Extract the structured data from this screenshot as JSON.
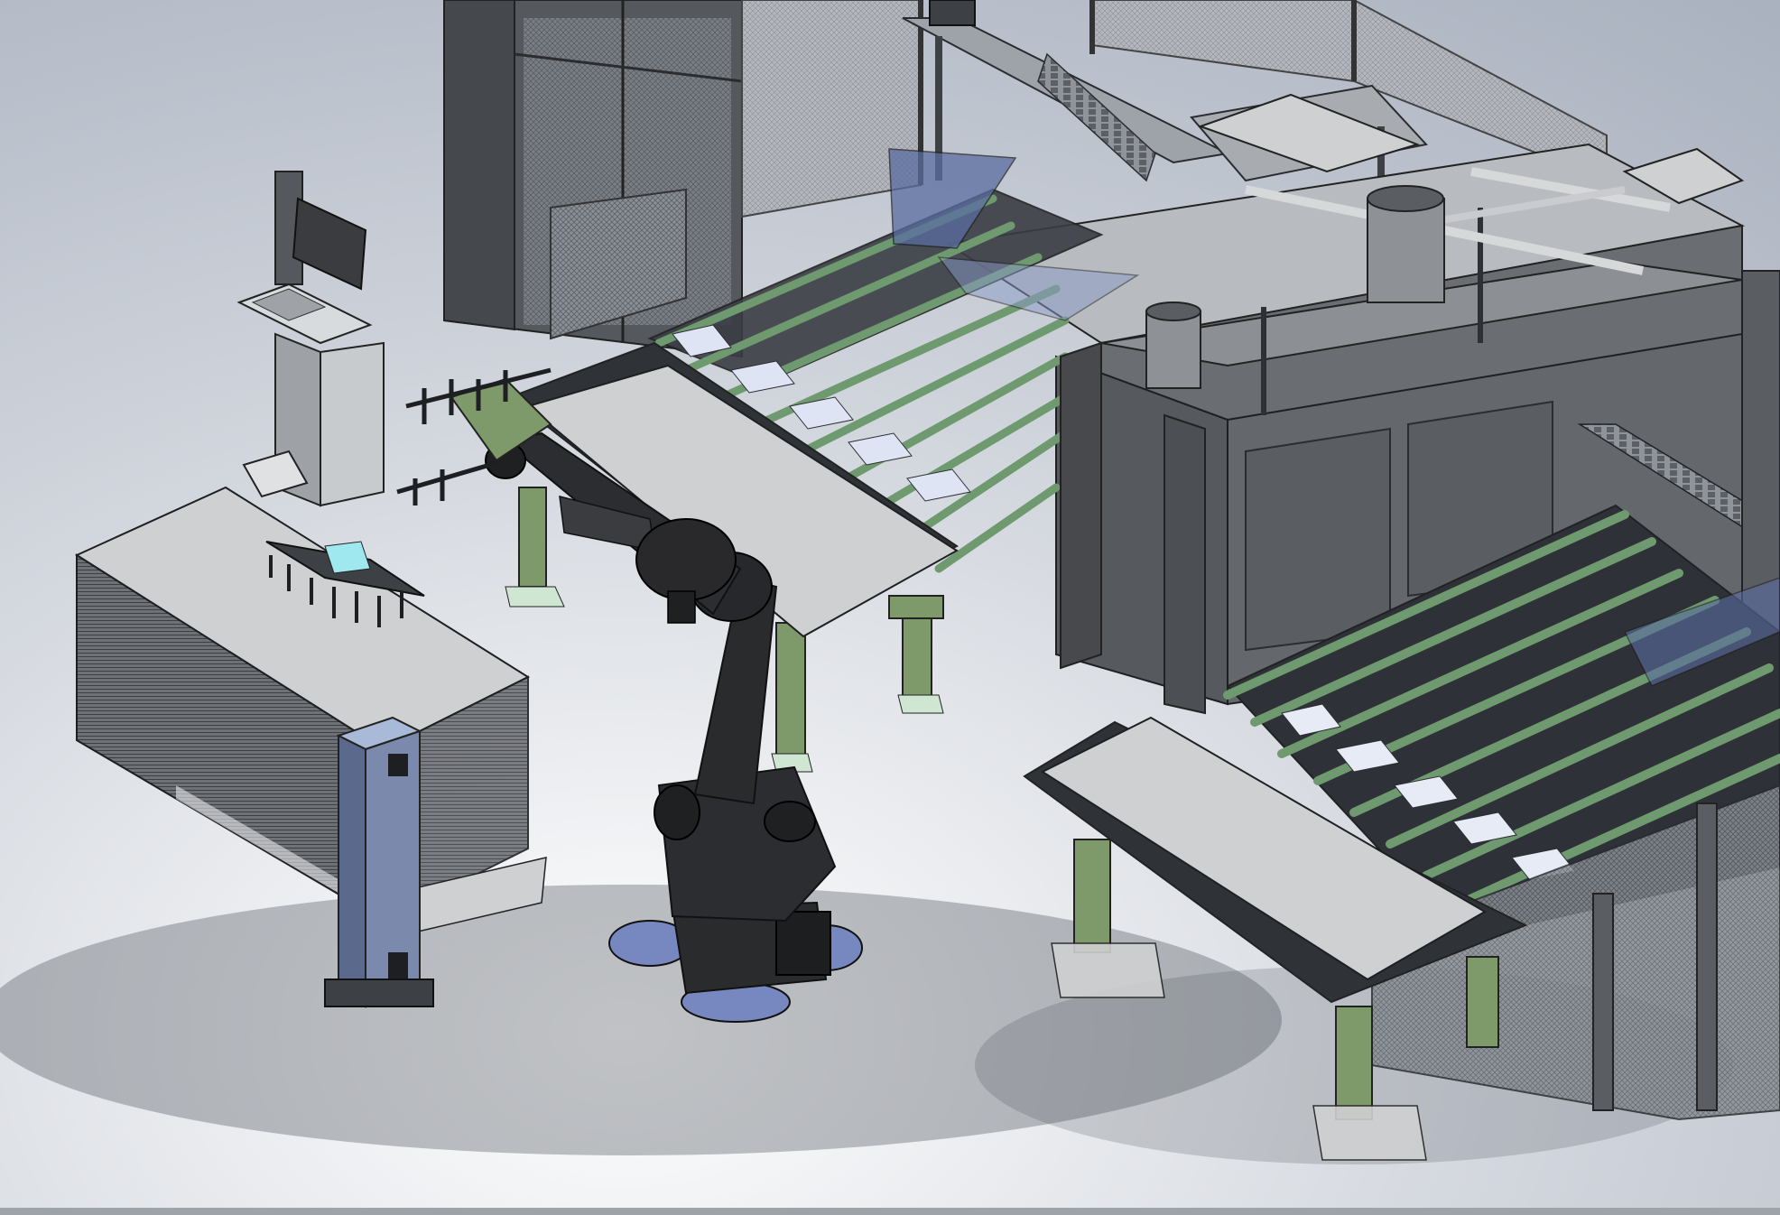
{
  "app": {
    "title": ""
  },
  "viewport": {
    "background_top": "#aeb6c3",
    "background_bottom": "#ffffff",
    "scene": "robotic-panel-handling-cell"
  },
  "colors": {
    "frame_green": "#7e9a6b",
    "frame_dark": "#3d4146",
    "machine_gray": "#5a5d62",
    "panel_light": "#cfd0d1",
    "robot_black": "#2a2b2d",
    "mesh_gray": "#7a7f86",
    "accent_blue": "#8aa0d6",
    "accent_cyan": "#9fe8ef"
  },
  "icons": {
    "robot": "industrial-robot-icon",
    "monitor": "monitor-icon",
    "keyboard": "keyboard-icon"
  }
}
